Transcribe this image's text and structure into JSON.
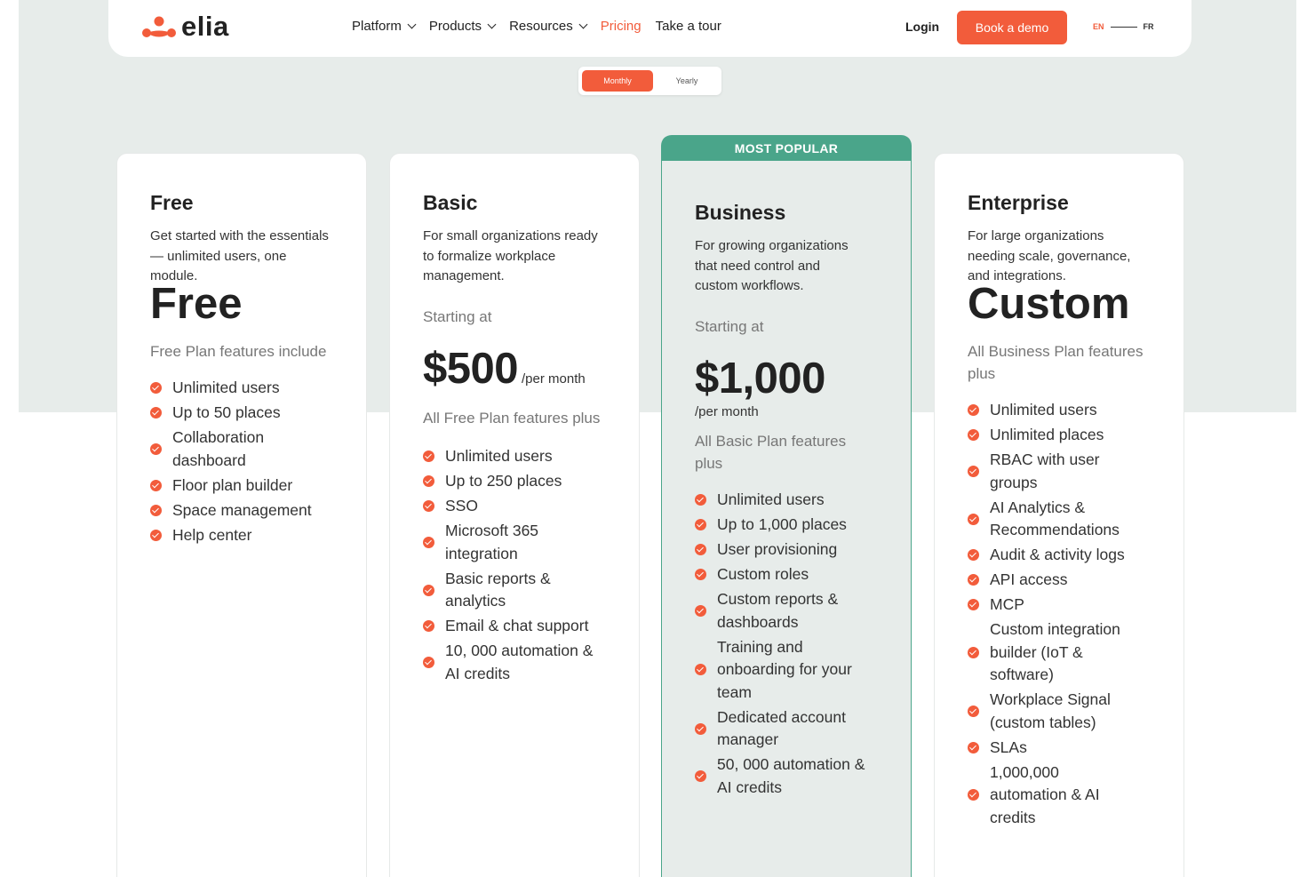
{
  "brand": {
    "name": "elia",
    "accent": "#f25c3b",
    "popular_color": "#4aa58a"
  },
  "nav": {
    "links": [
      {
        "label": "Platform",
        "dropdown": true
      },
      {
        "label": "Products",
        "dropdown": true
      },
      {
        "label": "Resources",
        "dropdown": true
      },
      {
        "label": "Pricing",
        "dropdown": false,
        "active": true
      },
      {
        "label": "Take a tour",
        "dropdown": false
      }
    ],
    "login": "Login",
    "cta": "Book a demo",
    "lang": {
      "en": "EN",
      "fr": "FR",
      "selected": "EN"
    }
  },
  "billing_toggle": {
    "monthly": "Monthly",
    "yearly": "Yearly",
    "selected": "Monthly"
  },
  "plans": [
    {
      "name": "Free",
      "description": "Get started with the essentials — unlimited users, one module.",
      "starting": "",
      "price": "Free",
      "per": "",
      "includes": "Free Plan features include",
      "features": [
        "Unlimited users",
        "Up to 50 places",
        "Collaboration dashboard",
        "Floor plan builder",
        "Space management",
        "Help center"
      ]
    },
    {
      "name": "Basic",
      "description": "For small organizations ready to formalize workplace management.",
      "starting": "Starting at",
      "price": "$500",
      "per": "/per month",
      "includes": "All Free Plan features plus",
      "features": [
        "Unlimited users",
        "Up to 250 places",
        "SSO",
        "Microsoft 365 integration",
        "Basic reports & analytics",
        "Email & chat support",
        "10, 000 automation & AI credits"
      ]
    },
    {
      "badge": "MOST POPULAR",
      "name": "Business",
      "description": "For growing organizations that need control and custom workflows.",
      "starting": "Starting at",
      "price": "$1,000",
      "per": "/per month",
      "includes": "All Basic Plan features plus",
      "features": [
        "Unlimited users",
        "Up to 1,000 places",
        "User provisioning",
        "Custom roles",
        "Custom reports & dashboards",
        "Training and onboarding for your team",
        "Dedicated account manager",
        "50, 000 automation & AI credits"
      ]
    },
    {
      "name": "Enterprise",
      "description": "For large organizations needing scale, governance, and integrations.",
      "starting": "",
      "price": "Custom",
      "per": "",
      "includes": "All Business Plan features plus",
      "features": [
        "Unlimited users",
        "Unlimited places",
        "RBAC with user groups",
        "AI Analytics & Recommendations",
        "Audit & activity logs",
        "API access",
        "MCP",
        "Custom integration builder (IoT & software)",
        "Workplace Signal (custom tables)",
        "SLAs",
        "1,000,000 automation & AI credits"
      ]
    }
  ]
}
